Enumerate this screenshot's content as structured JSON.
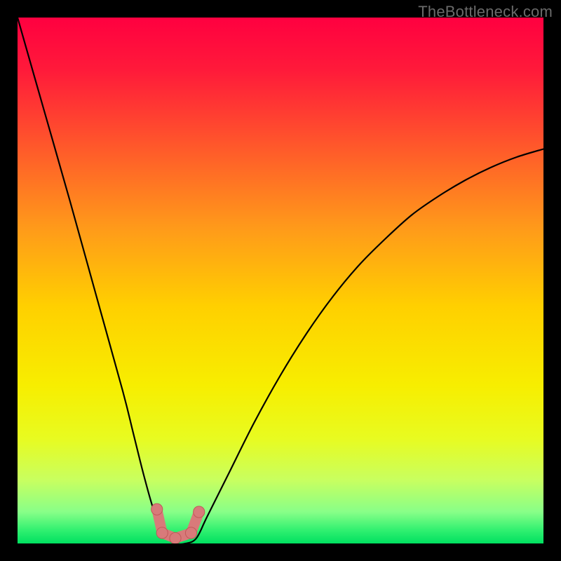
{
  "watermark": "TheBottleneck.com",
  "chart_data": {
    "type": "line",
    "title": "",
    "xlabel": "",
    "ylabel": "",
    "xlim": [
      0,
      100
    ],
    "ylim": [
      0,
      100
    ],
    "grid": false,
    "series": [
      {
        "name": "curve",
        "x": [
          0,
          5,
          10,
          15,
          20,
          22,
          24,
          26,
          28,
          30,
          32,
          34,
          36,
          40,
          45,
          50,
          55,
          60,
          65,
          70,
          75,
          80,
          85,
          90,
          95,
          100
        ],
        "values": [
          100,
          82.5,
          65,
          47,
          29,
          21,
          13,
          6,
          1.5,
          0,
          0,
          1,
          5,
          13,
          23,
          32,
          40,
          47,
          53,
          58,
          62.5,
          66,
          69,
          71.5,
          73.5,
          75
        ]
      }
    ],
    "gradient_stops": [
      {
        "offset": 0.0,
        "color": "#ff0040"
      },
      {
        "offset": 0.1,
        "color": "#ff1a3a"
      },
      {
        "offset": 0.25,
        "color": "#ff5a2a"
      },
      {
        "offset": 0.4,
        "color": "#ff9a1a"
      },
      {
        "offset": 0.55,
        "color": "#ffd000"
      },
      {
        "offset": 0.7,
        "color": "#f7ee00"
      },
      {
        "offset": 0.8,
        "color": "#e8fb20"
      },
      {
        "offset": 0.88,
        "color": "#c8ff60"
      },
      {
        "offset": 0.94,
        "color": "#88ff88"
      },
      {
        "offset": 0.975,
        "color": "#30f070"
      },
      {
        "offset": 1.0,
        "color": "#00e060"
      }
    ],
    "markers": [
      {
        "name": "marker-left-top",
        "x": 26.5,
        "y": 6.5,
        "r": 1.2
      },
      {
        "name": "marker-left-bottom",
        "x": 27.5,
        "y": 2.0,
        "r": 1.2
      },
      {
        "name": "marker-mid",
        "x": 30.0,
        "y": 1.0,
        "r": 1.2
      },
      {
        "name": "marker-right-bottom",
        "x": 33.0,
        "y": 2.0,
        "r": 1.2
      },
      {
        "name": "marker-right-top",
        "x": 34.5,
        "y": 6.0,
        "r": 1.2
      }
    ],
    "marker_color": "#d87a7a",
    "marker_stroke": "#c05858"
  }
}
